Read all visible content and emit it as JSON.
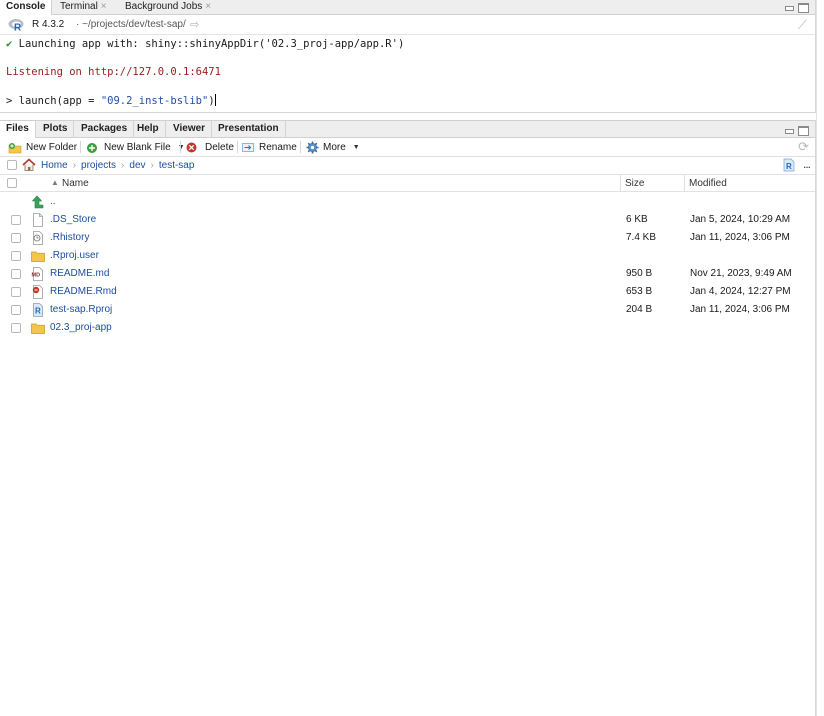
{
  "console": {
    "tabs": [
      {
        "label": "Console",
        "active": true,
        "closable": false
      },
      {
        "label": "Terminal",
        "active": false,
        "closable": true
      },
      {
        "label": "Background Jobs",
        "active": false,
        "closable": true
      }
    ],
    "r_version": "R 4.3.2",
    "path": "· ~/projects/dev/test-sap/",
    "lines": {
      "launch_check": "✔",
      "launch_msg": " Launching app with: shiny::shinyAppDir('02.3_proj-app/app.R')",
      "listening": "Listening on http://127.0.0.1:6471",
      "prompt": ">",
      "cmd_fn": " launch(app = ",
      "cmd_str": "\"09.2_inst-bslib\"",
      "cmd_close": ")"
    }
  },
  "files": {
    "tabs": [
      {
        "label": "Files",
        "active": true
      },
      {
        "label": "Plots",
        "active": false
      },
      {
        "label": "Packages",
        "active": false
      },
      {
        "label": "Help",
        "active": false
      },
      {
        "label": "Viewer",
        "active": false
      },
      {
        "label": "Presentation",
        "active": false
      }
    ],
    "toolbar": {
      "new_folder": "New Folder",
      "new_blank_file": "New Blank File",
      "delete": "Delete",
      "rename": "Rename",
      "more": "More"
    },
    "breadcrumbs": [
      "Home",
      "projects",
      "dev",
      "test-sap"
    ],
    "columns": {
      "name": "Name",
      "size": "Size",
      "modified": "Modified"
    },
    "up_label": "..",
    "rows": [
      {
        "name": ".DS_Store",
        "size": "6 KB",
        "modified": "Jan 5, 2024, 10:29 AM",
        "icon": "blank-file-icon"
      },
      {
        "name": ".Rhistory",
        "size": "7.4 KB",
        "modified": "Jan 11, 2024, 3:06 PM",
        "icon": "history-file-icon"
      },
      {
        "name": ".Rproj.user",
        "size": "",
        "modified": "",
        "icon": "folder-icon"
      },
      {
        "name": "README.md",
        "size": "950 B",
        "modified": "Nov 21, 2023, 9:49 AM",
        "icon": "markdown-file-icon"
      },
      {
        "name": "README.Rmd",
        "size": "653 B",
        "modified": "Jan 4, 2024, 12:27 PM",
        "icon": "rmarkdown-file-icon"
      },
      {
        "name": "test-sap.Rproj",
        "size": "204 B",
        "modified": "Jan 11, 2024, 3:06 PM",
        "icon": "rproj-file-icon"
      },
      {
        "name": "02.3_proj-app",
        "size": "",
        "modified": "",
        "icon": "folder-icon"
      }
    ]
  },
  "colors": {
    "link": "#1b4d9e",
    "listening": "#9b1c1c",
    "string": "#1c4fa5",
    "check": "#2e8b2e",
    "folder": "#f2c64a"
  }
}
